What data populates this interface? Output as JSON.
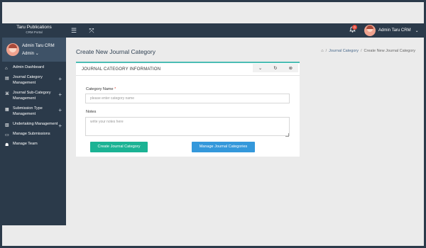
{
  "brand": {
    "title": "Taru Publications",
    "subtitle": "CRM Portal"
  },
  "topbar": {
    "menu_icon": "hamburger-icon",
    "expand_icon": "expand-icon",
    "bell_icon": "bell-icon",
    "notification_count": "0",
    "user_name": "Admin Taru CRM",
    "caret": "⌄"
  },
  "user_panel": {
    "name": "Admin Taru CRM",
    "role": "Admin"
  },
  "sidebar": {
    "items": [
      {
        "label": "Admin Dashboard",
        "icon": "home-icon",
        "expandable": false
      },
      {
        "label": "Journal Category Management",
        "icon": "document-icon",
        "expandable": true
      },
      {
        "label": "Journal Sub-Category Management",
        "icon": "sitemap-icon",
        "expandable": true
      },
      {
        "label": "Submission Type Management",
        "icon": "file-icon",
        "expandable": true
      },
      {
        "label": "Undertaking Management",
        "icon": "file-edit-icon",
        "expandable": true
      },
      {
        "label": "Manage Submissions",
        "icon": "list-icon",
        "expandable": false
      },
      {
        "label": "Manage Team",
        "icon": "users-icon",
        "expandable": false
      }
    ]
  },
  "page": {
    "title": "Create New Journal Category",
    "breadcrumb": [
      "Journal Category",
      "Create New Journal Category"
    ]
  },
  "card": {
    "title": "JOURNAL CATEGORY INFORMATION",
    "tools": [
      "collapse",
      "refresh",
      "close"
    ]
  },
  "form": {
    "category_label": "Category Name",
    "required_mark": "*",
    "category_placeholder": "please enter category name",
    "category_value": "",
    "notes_label": "Notes",
    "notes_placeholder": "write your notes here",
    "notes_value": "",
    "create_button": "Create Journal Category",
    "manage_button": "Manage Journal Categories"
  },
  "colors": {
    "sidebar_bg": "#2b3a4a",
    "user_panel_bg": "#3e5267",
    "content_bg": "#ebebeb",
    "card_accent": "#4bbdb4",
    "create_button": "#1bb394",
    "manage_button": "#3498db",
    "badge": "#e54b3c"
  }
}
